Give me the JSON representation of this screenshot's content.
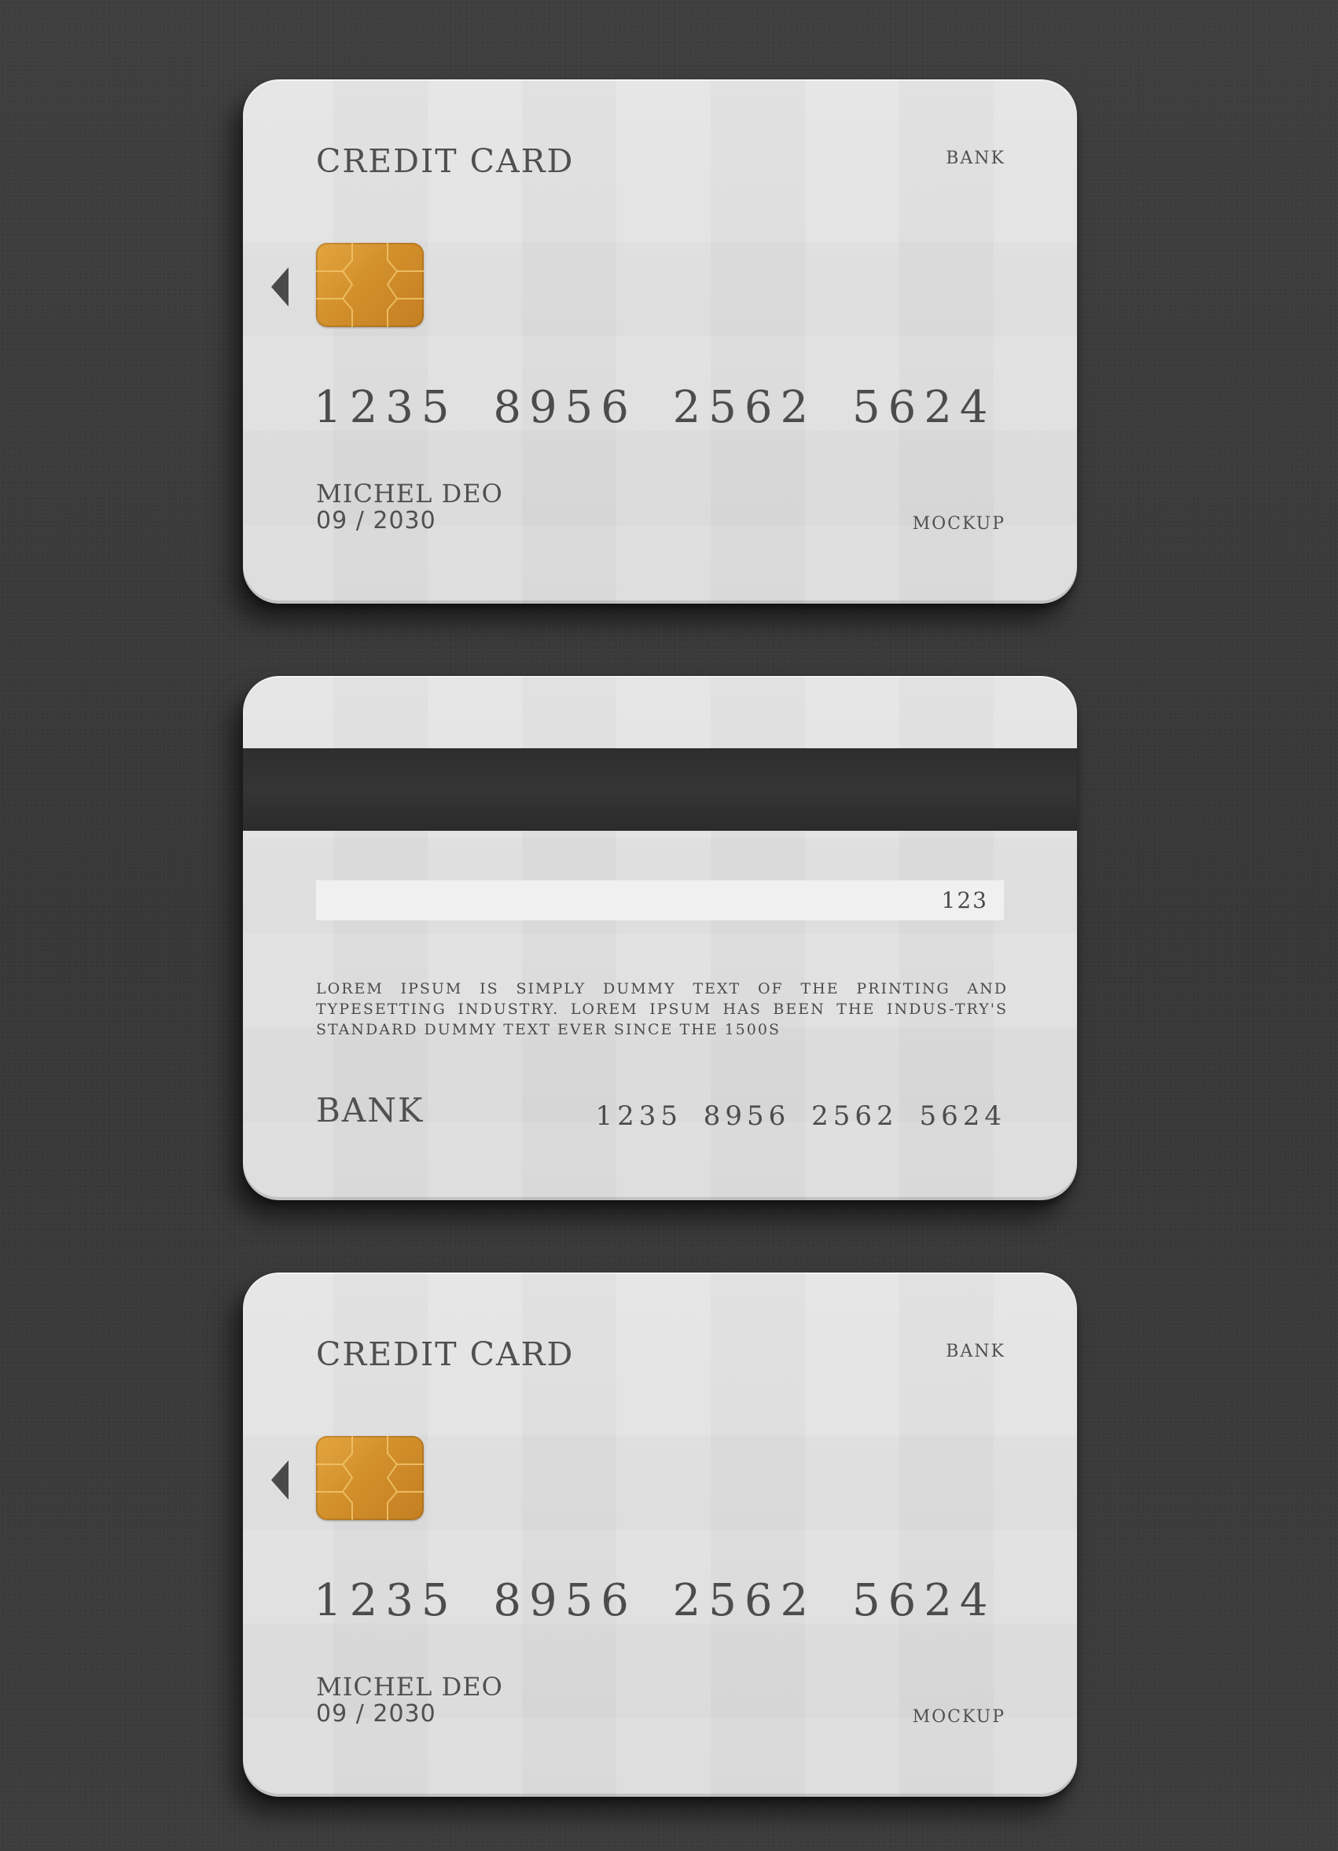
{
  "cards": [
    {
      "side": "front",
      "title": "CREDIT CARD",
      "bank": "BANK",
      "number": "1235 8956 2562 5624",
      "holder": "MICHEL DEO",
      "expiry": "09 / 2030",
      "footer": "MOCKUP",
      "chip_color": "#d6952f"
    },
    {
      "side": "back",
      "cvv": "123",
      "text": "LOREM IPSUM IS SIMPLY DUMMY TEXT OF THE PRINTING AND TYPESETTING INDUSTRY. LOREM IPSUM HAS BEEN THE INDUS-TRY'S STANDARD DUMMY TEXT EVER SINCE THE 1500S",
      "bank": "BANK",
      "number": "1235 8956 2562 5624",
      "stripe_color": "#313131"
    },
    {
      "side": "front",
      "title": "CREDIT CARD",
      "bank": "BANK",
      "number": "1235 8956 2562 5624",
      "holder": "MICHEL DEO",
      "expiry": "09 / 2030",
      "footer": "MOCKUP",
      "chip_color": "#d6952f"
    }
  ],
  "background_color": "#3c3c3c",
  "card_color": "#e2e2e2"
}
